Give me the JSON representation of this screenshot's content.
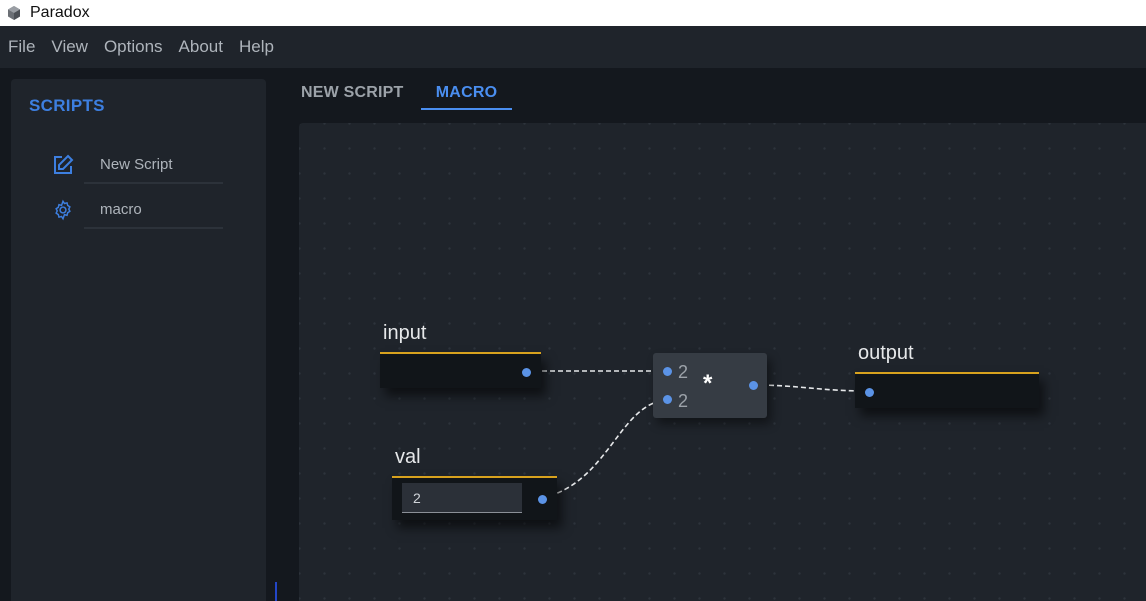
{
  "window": {
    "title": "Paradox"
  },
  "menu": [
    "File",
    "View",
    "Options",
    "About",
    "Help"
  ],
  "sidebar": {
    "title": "SCRIPTS",
    "items": [
      {
        "label": "New Script",
        "icon": "edit-icon"
      },
      {
        "label": "macro",
        "icon": "gear-icon"
      }
    ]
  },
  "tabs": [
    {
      "label": "NEW SCRIPT",
      "active": false
    },
    {
      "label": "MACRO",
      "active": true
    }
  ],
  "graph": {
    "nodes": {
      "input": {
        "label": "input"
      },
      "val": {
        "label": "val",
        "value": "2"
      },
      "multiply": {
        "symbol": "*",
        "in1": "2",
        "in2": "2"
      },
      "output": {
        "label": "output"
      }
    }
  },
  "colors": {
    "accent": "#4a8ef0",
    "node_border": "#d8a21e",
    "port": "#5b93e6"
  }
}
